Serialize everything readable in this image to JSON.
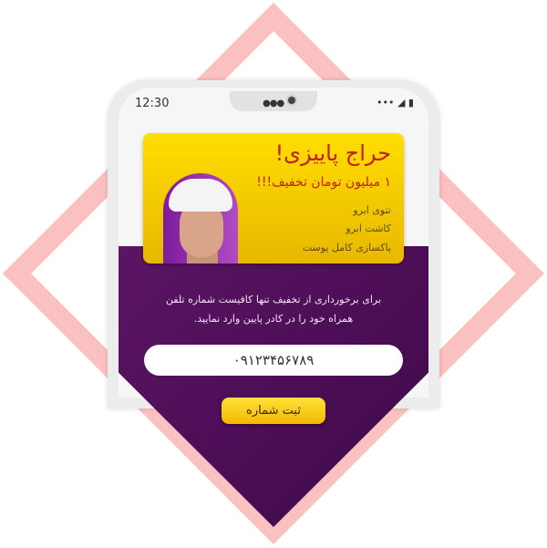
{
  "status_bar": {
    "time": "12:30",
    "icons": "••• ◢ ▮"
  },
  "promo": {
    "title": "حراج پاییزی!",
    "subtitle": "۱ میلیون تومان تخفیف!!!",
    "services": [
      "تتوی ابرو",
      "کاشت ابرو",
      "پاکسازی کامل پوست"
    ]
  },
  "description_line1": "برای برخورداری از تخفیف تنها کافیست شماره تلفن",
  "description_line2": "همراه خود را در کادر پایین وارد نمایید.",
  "phone_input": {
    "value": "۰۹۱۲۳۴۵۶۷۸۹"
  },
  "submit_label": "ثبت شماره",
  "colors": {
    "accent_pink": "#fbc0c0",
    "purple": "#4e0f58",
    "yellow": "#ffd800",
    "title_red": "#c0201f"
  }
}
